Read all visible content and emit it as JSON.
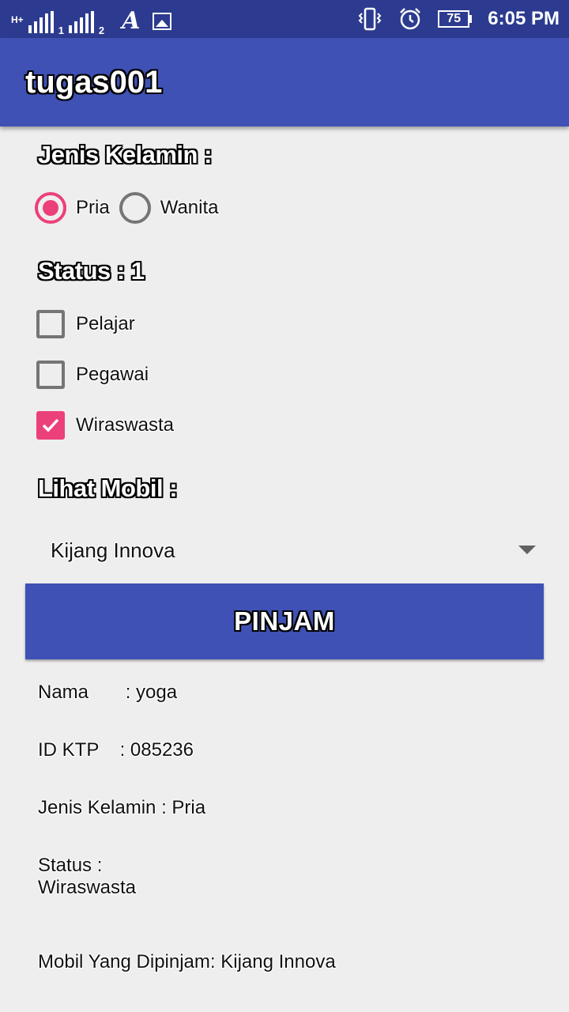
{
  "status_bar": {
    "network_type": "H+",
    "sim1": "1",
    "sim2": "2",
    "battery_level": "75",
    "time": "6:05 PM",
    "icons": [
      "signal-icon",
      "font-icon",
      "image-icon",
      "vibrate-icon",
      "alarm-icon",
      "battery-icon"
    ]
  },
  "app_bar": {
    "title": "tugas001"
  },
  "gender": {
    "heading": "Jenis Kelamin :",
    "options": [
      {
        "label": "Pria",
        "selected": true
      },
      {
        "label": "Wanita",
        "selected": false
      }
    ]
  },
  "status": {
    "heading": "Status : 1",
    "options": [
      {
        "label": "Pelajar",
        "checked": false
      },
      {
        "label": "Pegawai",
        "checked": false
      },
      {
        "label": "Wiraswasta",
        "checked": true
      }
    ]
  },
  "car": {
    "heading": "Lihat Mobil :",
    "selected": "Kijang Innova"
  },
  "button": {
    "label": "PINJAM"
  },
  "result": {
    "nama": "Nama       : yoga",
    "id_ktp": "ID KTP    : 085236",
    "jenis_kelamin": "Jenis Kelamin : Pria",
    "status_label": "Status :",
    "status_value": "Wiraswasta",
    "mobil": "Mobil Yang Dipinjam: Kijang Innova"
  },
  "colors": {
    "status_bar": "#2c3b8f",
    "primary": "#3f51b5",
    "accent": "#ec407a",
    "background": "#eeeeee"
  }
}
